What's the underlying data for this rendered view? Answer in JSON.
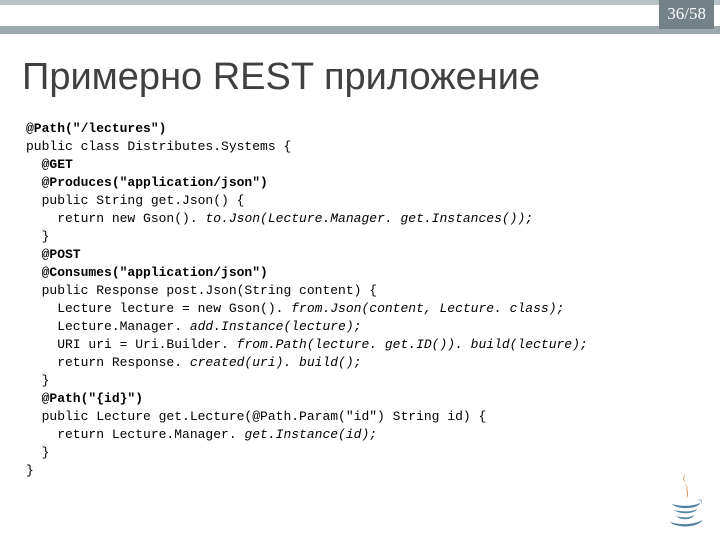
{
  "page_number": "36/58",
  "title": "Примерно REST приложение",
  "code": {
    "l1": "@Path(\"/lectures\")",
    "l2": "public class Distributes.Systems {",
    "l3": "  @GET",
    "l4": "  @Produces(\"application/json\")",
    "l5": "  public String get.Json() {",
    "l6p": "    return new Gson(). ",
    "l6i": "to.Json(Lecture.Manager. get.Instances());",
    "l7": "  }",
    "l8": "  @POST",
    "l9": "  @Consumes(\"application/json\")",
    "l10": "  public Response post.Json(String content) {",
    "l11p": "    Lecture lecture = new Gson(). ",
    "l11i": "from.Json(content, Lecture. class);",
    "l12p": "    Lecture.Manager. ",
    "l12i": "add.Instance(lecture);",
    "l13p": "    URI uri = Uri.Builder. ",
    "l13i": "from.Path(lecture. get.ID()). build(lecture);",
    "l14p": "    return Response. ",
    "l14i": "created(uri). build();",
    "l15": "  }",
    "l16": "  @Path(\"{id}\")",
    "l17": "  public Lecture get.Lecture(@Path.Param(\"id\") String id) {",
    "l18p": "    return Lecture.Manager. ",
    "l18i": "get.Instance(id);",
    "l19": "  }",
    "l20": "}"
  }
}
